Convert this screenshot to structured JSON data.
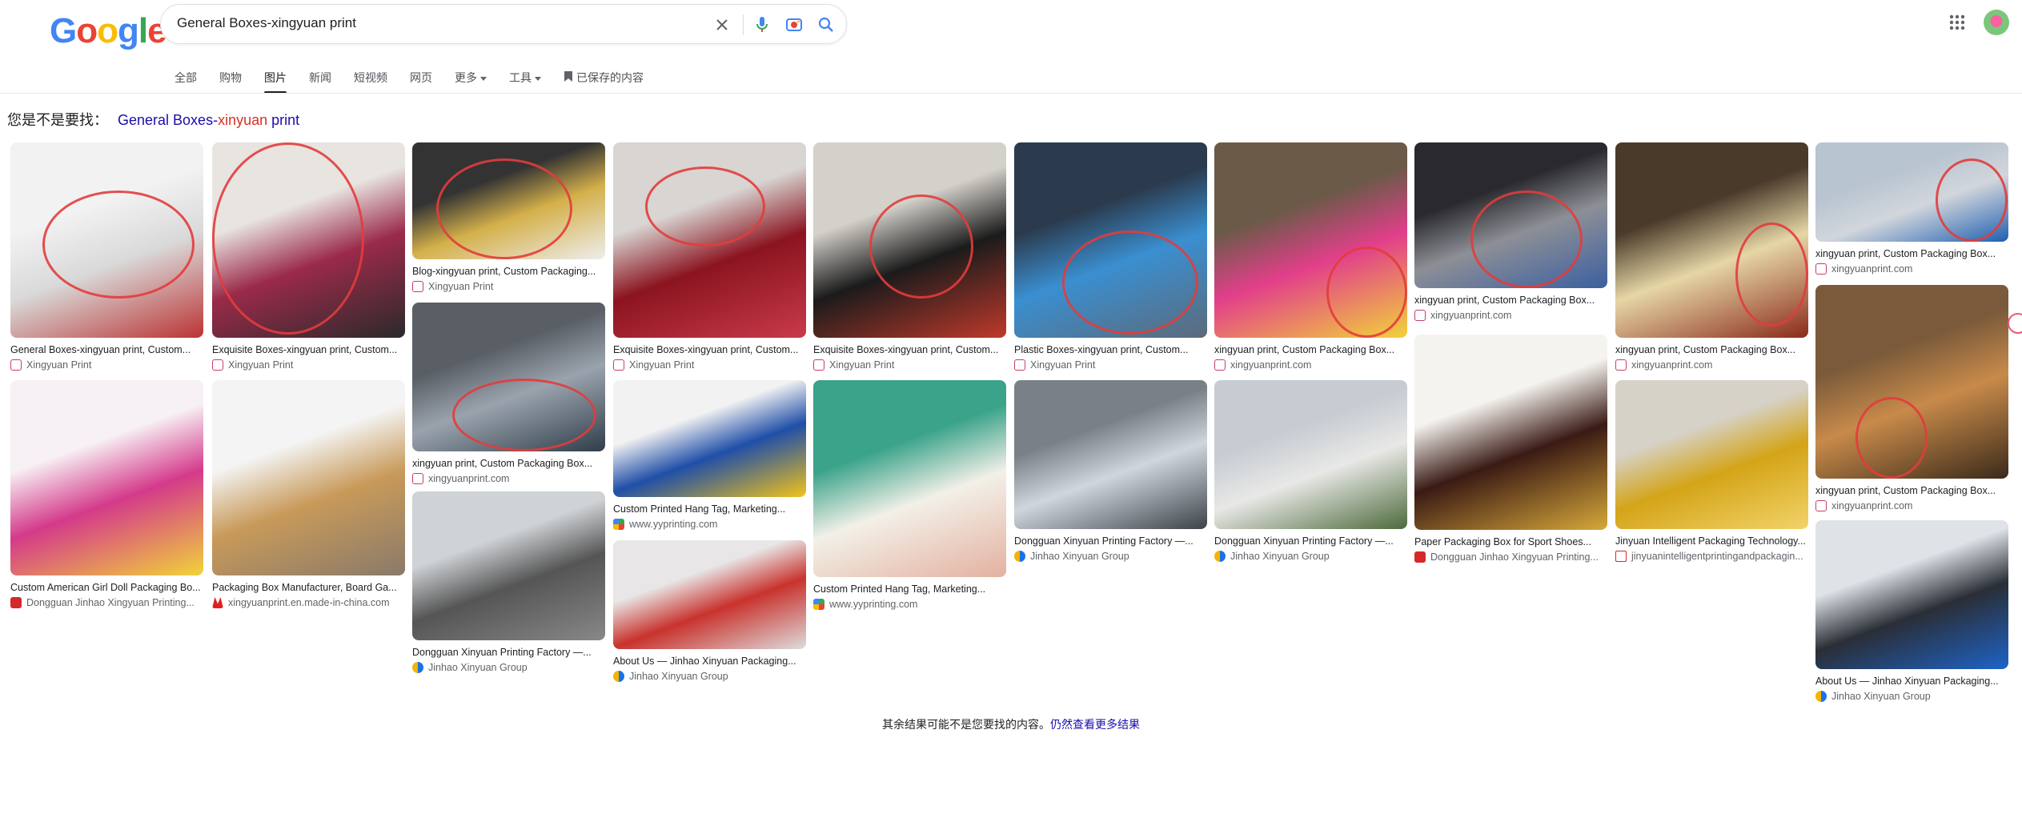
{
  "logo_letters": [
    {
      "ch": "G",
      "color": "#4285F4"
    },
    {
      "ch": "o",
      "color": "#EA4335"
    },
    {
      "ch": "o",
      "color": "#FBBC05"
    },
    {
      "ch": "g",
      "color": "#4285F4"
    },
    {
      "ch": "l",
      "color": "#34A853"
    },
    {
      "ch": "e",
      "color": "#EA4335"
    }
  ],
  "search": {
    "query": "General Boxes-xingyuan print"
  },
  "icons": {
    "clear": "close-icon",
    "voice": "mic-icon",
    "lens": "lens-icon",
    "search": "search-icon",
    "apps": "apps-grid-icon"
  },
  "tabs": [
    {
      "label": "全部",
      "active": false,
      "dropdown": false
    },
    {
      "label": "购物",
      "active": false,
      "dropdown": false
    },
    {
      "label": "图片",
      "active": true,
      "dropdown": false
    },
    {
      "label": "新闻",
      "active": false,
      "dropdown": false
    },
    {
      "label": "短视频",
      "active": false,
      "dropdown": false
    },
    {
      "label": "网页",
      "active": false,
      "dropdown": false
    },
    {
      "label": "更多",
      "active": false,
      "dropdown": true
    },
    {
      "label": "工具",
      "active": false,
      "dropdown": true
    },
    {
      "label": "已保存的内容",
      "active": false,
      "dropdown": false,
      "icon": "bookmark-icon"
    }
  ],
  "did_you_mean": {
    "prefix": "您是不是要找：",
    "s1": "General Boxes-",
    "s2": "xinyuan",
    "s3": " print"
  },
  "results": [
    {
      "title": "General Boxes-xingyuan print, Custom...",
      "source": "Xingyuan Print",
      "fav": "xy",
      "colors": [
        "#f2f2f2",
        "#d9d9d9",
        "#b33"
      ]
    },
    {
      "title": "Exquisite Boxes-xingyuan print, Custom...",
      "source": "Xingyuan Print",
      "fav": "xy",
      "colors": [
        "#e8e4e0",
        "#9a2a4a",
        "#2a2a2a"
      ]
    },
    {
      "title": "Blog-xingyuan print, Custom Packaging...",
      "source": "Xingyuan Print",
      "fav": "xy",
      "colors": [
        "#333",
        "#d4b04a",
        "#eee"
      ]
    },
    {
      "title": "xingyuan print, Custom Packaging Box...",
      "source": "xingyuanprint.com",
      "fav": "xy",
      "colors": [
        "#5a5f66",
        "#9aa3ad",
        "#2f3d4a"
      ]
    },
    {
      "title": "Dongguan Xinyuan Printing Factory —...",
      "source": "Jinhao Xinyuan Group",
      "fav": "jh",
      "colors": [
        "#cfd3d6",
        "#555",
        "#888"
      ]
    },
    {
      "title": "Exquisite Boxes-xingyuan print, Custom...",
      "source": "Xingyuan Print",
      "fav": "xy",
      "colors": [
        "#d8d5d2",
        "#8b1420",
        "#c93a4a"
      ]
    },
    {
      "title": "Custom Printed Hang Tag, Marketing...",
      "source": "www.yyprinting.com",
      "fav": "yy",
      "colors": [
        "#f2f2f2",
        "#1f4fa8",
        "#f1c21b"
      ]
    },
    {
      "title": "About Us — Jinhao Xinyuan Packaging...",
      "source": "Jinhao Xinyuan Group",
      "fav": "jh",
      "colors": [
        "#e8e6e6",
        "#c9322d",
        "#ddd"
      ]
    },
    {
      "title": "Exquisite Boxes-xingyuan print, Custom...",
      "source": "Xingyuan Print",
      "fav": "xy",
      "colors": [
        "#d4d0ca",
        "#1b1b1b",
        "#c0392b"
      ]
    },
    {
      "title": "Custom Printed Hang Tag, Marketing...",
      "source": "www.yyprinting.com",
      "fav": "yy",
      "colors": [
        "#3aa38a",
        "#f3f0e8",
        "#e3b1a0"
      ]
    },
    {
      "title": "Plastic Boxes-xingyuan print, Custom...",
      "source": "Xingyuan Print",
      "fav": "xy",
      "colors": [
        "#2b3a4d",
        "#3a8fd1",
        "#5c6a7a"
      ]
    },
    {
      "title": "Dongguan Xinyuan Printing Factory —...",
      "source": "Jinhao Xinyuan Group",
      "fav": "jh",
      "colors": [
        "#7a8088",
        "#cfd6dd",
        "#3c4248"
      ]
    },
    {
      "title": "xingyuan print, Custom Packaging Box...",
      "source": "xingyuanprint.com",
      "fav": "xy",
      "colors": [
        "#6b5a48",
        "#e23f8a",
        "#f2d23a"
      ]
    },
    {
      "title": "Dongguan Xinyuan Printing Factory —...",
      "source": "Jinhao Xinyuan Group",
      "fav": "jh",
      "colors": [
        "#c6ccd2",
        "#e8e8e6",
        "#4d6a3c"
      ]
    },
    {
      "title": "xingyuan print, Custom Packaging Box...",
      "source": "xingyuanprint.com",
      "fav": "xy",
      "colors": [
        "#2a2a2e",
        "#8d8f96",
        "#3b5fa0"
      ]
    },
    {
      "title": "Paper Packaging Box for Sport Shoes...",
      "source": "Dongguan Jinhao Xingyuan Printing...",
      "fav": "dj",
      "colors": [
        "#f5f3ef",
        "#3a1a14",
        "#d7a83a"
      ]
    },
    {
      "title": "xingyuan print, Custom Packaging Box...",
      "source": "xingyuanprint.com",
      "fav": "xy",
      "colors": [
        "#4a3a2a",
        "#e6d6a6",
        "#8a2a1a"
      ]
    },
    {
      "title": "Jinyuan Intelligent Packaging Technology...",
      "source": "jinyuanintelligentprintingandpackagin...",
      "fav": "jy",
      "colors": [
        "#d6d2c8",
        "#d4a418",
        "#f2d36a"
      ]
    },
    {
      "title": "xingyuan print, Custom Packaging Box...",
      "source": "xingyuanprint.com",
      "fav": "xy",
      "colors": [
        "#b8c4d0",
        "#d2d6dc",
        "#1f5fb0"
      ]
    },
    {
      "title": "xingyuan print, Custom Packaging Box...",
      "source": "xingyuanprint.com",
      "fav": "xy",
      "colors": [
        "#7a5a3a",
        "#c88a4a",
        "#3a2a1a"
      ]
    },
    {
      "title": "About Us — Jinhao Xinyuan Packaging...",
      "source": "Jinhao Xinyuan Group",
      "fav": "jh",
      "colors": [
        "#dfe3e8",
        "#2a2e36",
        "#1e63c8"
      ]
    },
    {
      "title": "Custom American Girl Doll Packaging Bo...",
      "source": "Dongguan Jinhao Xingyuan Printing...",
      "fav": "dj",
      "colors": [
        "#f7f0f4",
        "#d43a8a",
        "#f1d33a"
      ]
    },
    {
      "title": "Packaging Box Manufacturer, Board Ga...",
      "source": "xingyuanprint.en.made-in-china.com",
      "fav": "mc",
      "colors": [
        "#f4f4f4",
        "#c89a5a",
        "#8a7a6a"
      ]
    }
  ],
  "footer": {
    "text": "其余结果可能不是您要找的内容。",
    "link": "仍然查看更多结果"
  }
}
